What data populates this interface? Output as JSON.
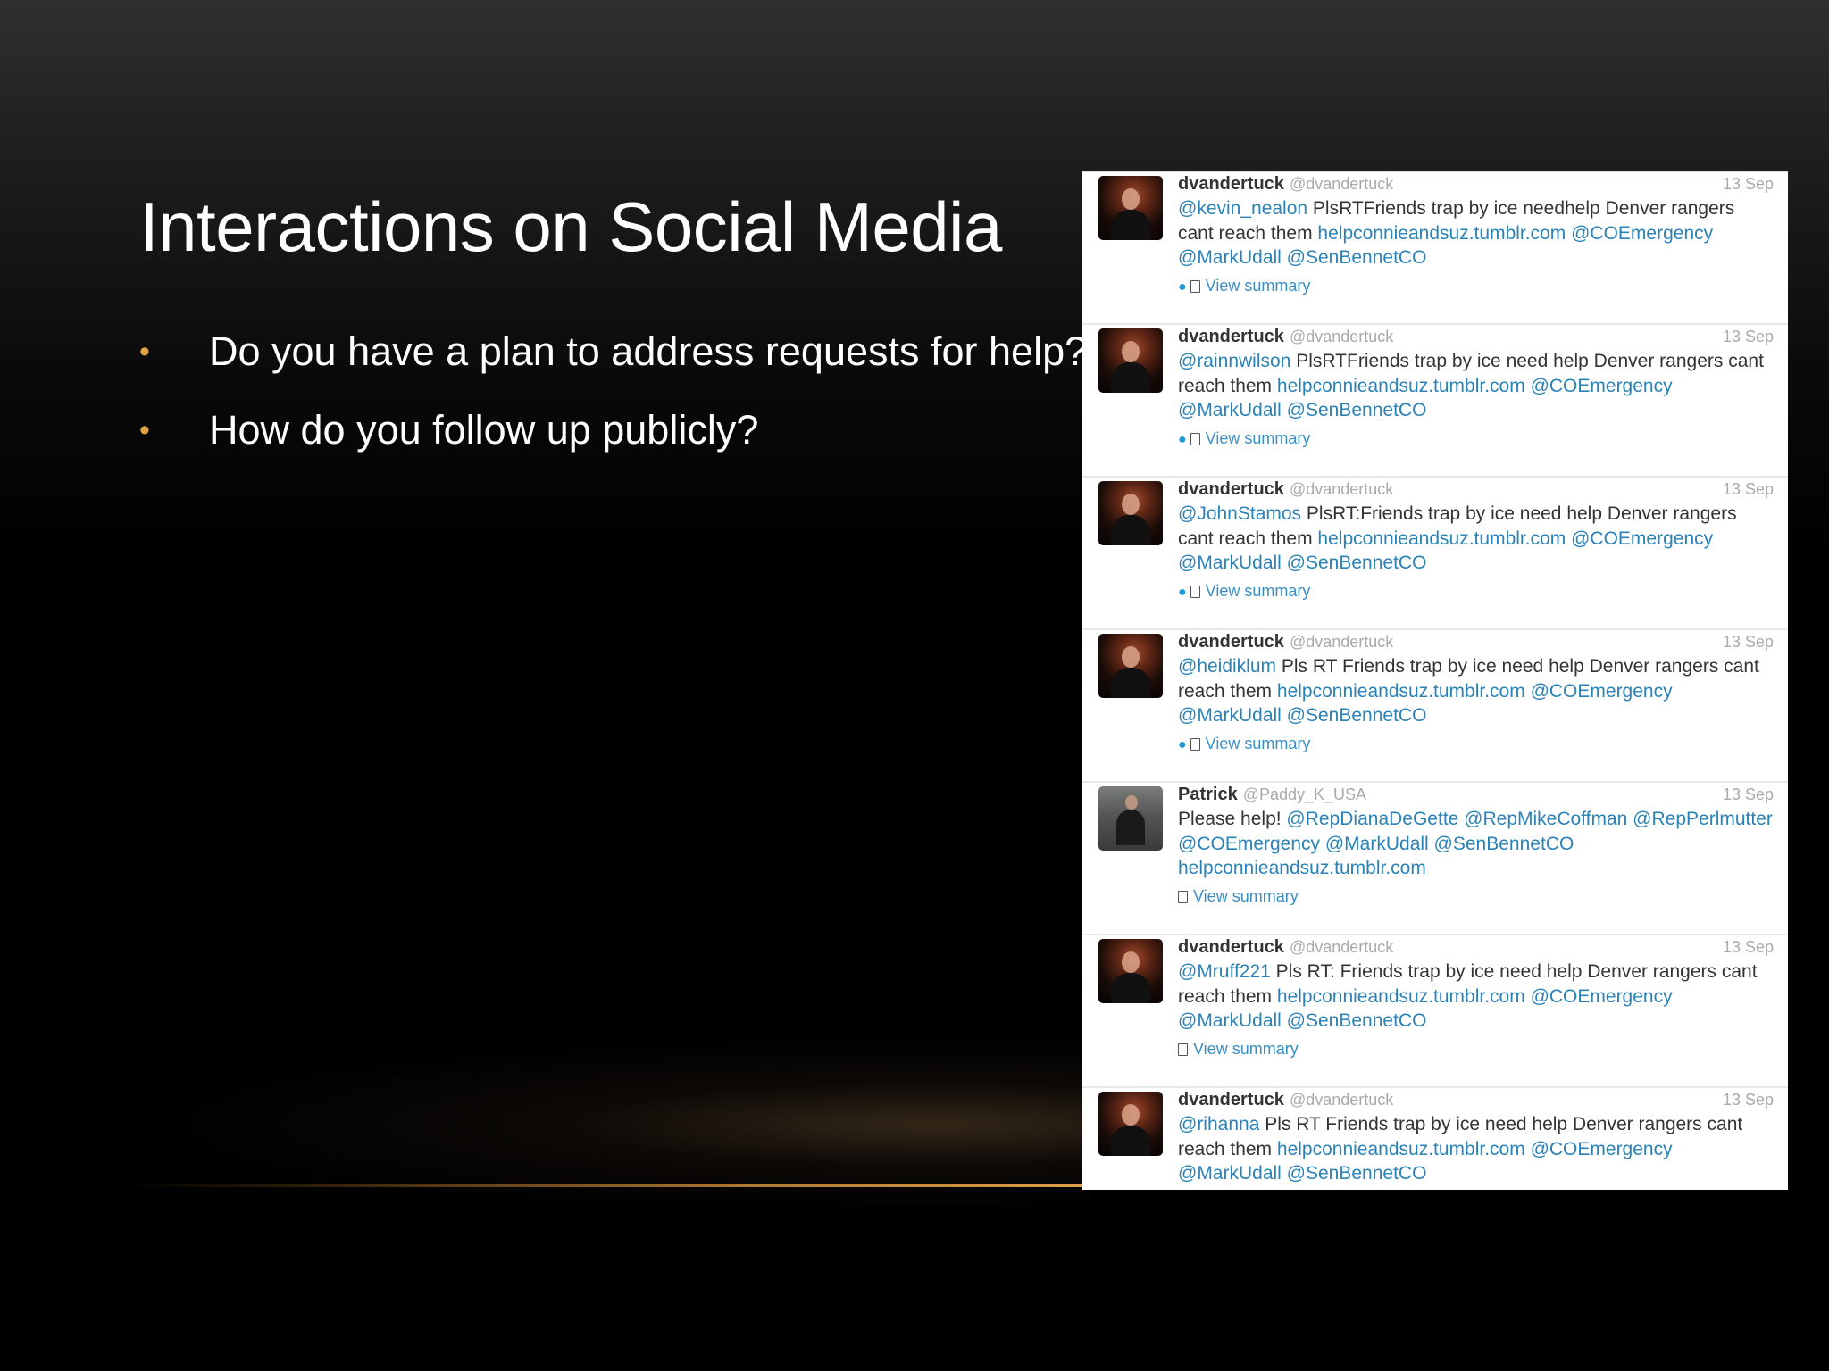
{
  "slide": {
    "title": "Interactions on Social Media",
    "bullet_marker": "•",
    "bullets": [
      "Do you have a plan to address requests for help?",
      "How do you follow up publicly?"
    ]
  },
  "feed": {
    "view_summary_label": "View summary",
    "tweets": [
      {
        "name": "dvandertuck",
        "handle": "@dvandertuck",
        "date": "13 Sep",
        "mention": "@kevin_nealon",
        "body": " PlsRTFriends trap by ice needhelp Denver rangers cant reach them ",
        "url": "helpconnieandsuz.tumblr.com",
        "tail": " @COEmergency @MarkUdall @SenBennetCO",
        "has_convo": true
      },
      {
        "name": "dvandertuck",
        "handle": "@dvandertuck",
        "date": "13 Sep",
        "mention": "@rainnwilson",
        "body": " PlsRTFriends trap by ice need help Denver rangers cant reach them ",
        "url": "helpconnieandsuz.tumblr.com",
        "tail": " @COEmergency @MarkUdall @SenBennetCO",
        "has_convo": true
      },
      {
        "name": "dvandertuck",
        "handle": "@dvandertuck",
        "date": "13 Sep",
        "mention": "@JohnStamos",
        "body": " PlsRT:Friends trap by ice need help Denver rangers cant reach them ",
        "url": "helpconnieandsuz.tumblr.com",
        "tail": " @COEmergency @MarkUdall @SenBennetCO",
        "has_convo": true
      },
      {
        "name": "dvandertuck",
        "handle": "@dvandertuck",
        "date": "13 Sep",
        "mention": "@heidiklum",
        "body": " Pls RT Friends trap by ice need help Denver rangers cant reach them ",
        "url": "helpconnieandsuz.tumblr.com",
        "tail": " @COEmergency @MarkUdall @SenBennetCO",
        "has_convo": true
      },
      {
        "name": "Patrick",
        "handle": "@Paddy_K_USA",
        "date": "13 Sep",
        "mention": "",
        "body": "Please help! ",
        "url": "",
        "tail": "@RepDianaDeGette @RepMikeCoffman @RepPerlmutter @COEmergency @MarkUdall @SenBennetCO helpconnieandsuz.tumblr.com",
        "has_convo": false
      },
      {
        "name": "dvandertuck",
        "handle": "@dvandertuck",
        "date": "13 Sep",
        "mention": "@Mruff221",
        "body": " Pls RT: Friends trap by ice need help Denver rangers cant reach them ",
        "url": "helpconnieandsuz.tumblr.com",
        "tail": " @COEmergency @MarkUdall @SenBennetCO",
        "has_convo": false
      },
      {
        "name": "dvandertuck",
        "handle": "@dvandertuck",
        "date": "13 Sep",
        "mention": "@rihanna",
        "body": " Pls RT Friends trap by ice need help Denver rangers cant reach them ",
        "url": "helpconnieandsuz.tumblr.com",
        "tail": " @COEmergency @MarkUdall @SenBennetCO",
        "has_convo": false
      }
    ]
  },
  "icons": {
    "conversation": "speech-bubble-icon",
    "summary": "document-icon"
  },
  "colors": {
    "bullet": "#e0a542",
    "link": "#2a82b7",
    "background": "#000000"
  }
}
